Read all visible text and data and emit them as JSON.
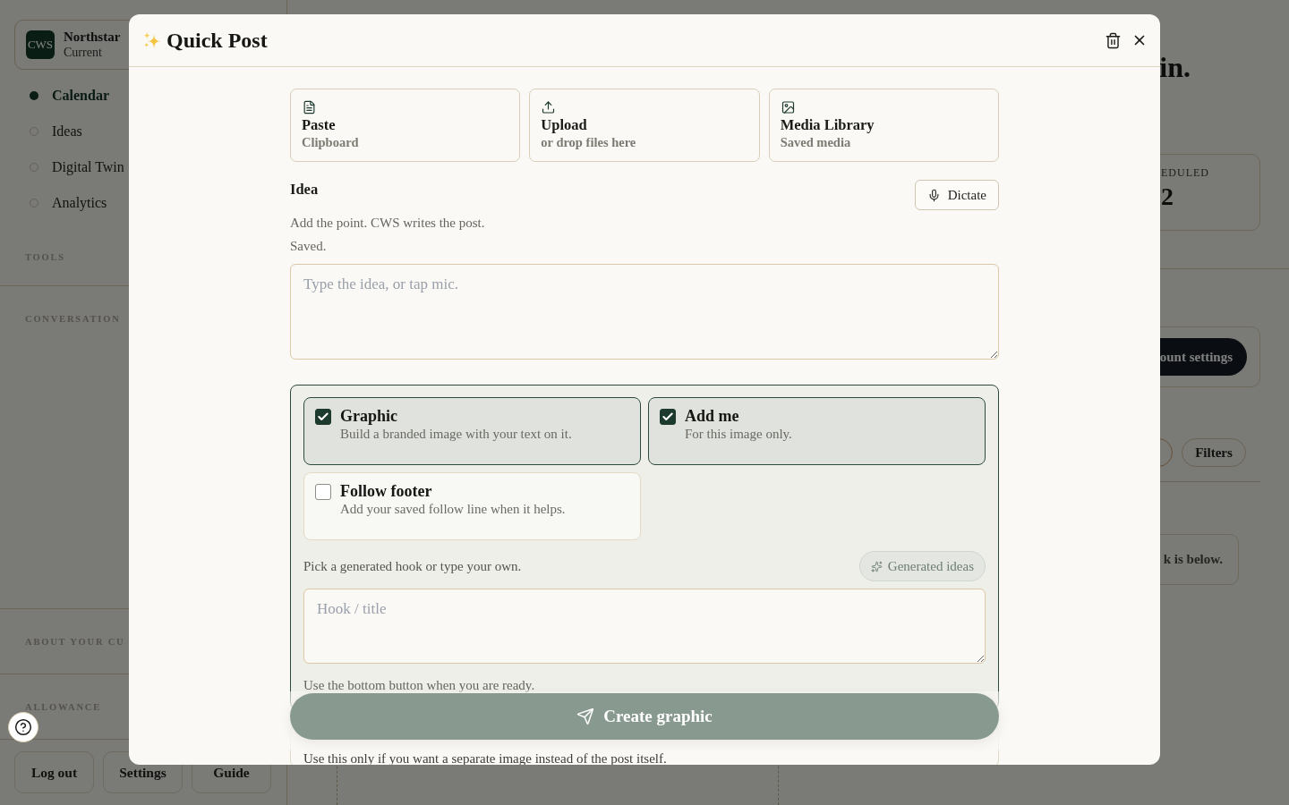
{
  "sidebar": {
    "workspace": {
      "logo": "CWS",
      "name": "Northstar",
      "status": "Current"
    },
    "nav": [
      {
        "label": "Calendar",
        "selected": true
      },
      {
        "label": "Ideas",
        "selected": false
      },
      {
        "label": "Digital Twin",
        "selected": false
      },
      {
        "label": "Analytics",
        "selected": false
      }
    ],
    "top_sections": [
      {
        "title": "TOOLS"
      },
      {
        "title": "CONVERSATION"
      }
    ],
    "bottom_sections": [
      {
        "title": "ABOUT YOUR CU"
      },
      {
        "title": "ALLOWANCE"
      }
    ],
    "buttons": [
      "Log out",
      "Settings",
      "Guide"
    ]
  },
  "main": {
    "heading": "in.",
    "stat": {
      "label": "EDULED",
      "value": "2"
    },
    "settings_button": "ount settings",
    "filters_button": "Filters",
    "notice": "k is below."
  },
  "modal": {
    "title": "Quick Post",
    "sources": [
      {
        "kind": "paste",
        "title": "Paste",
        "subtitle": "Clipboard"
      },
      {
        "kind": "upload",
        "title": "Upload",
        "subtitle": "or drop files here"
      },
      {
        "kind": "media",
        "title": "Media Library",
        "subtitle": "Saved media"
      }
    ],
    "idea": {
      "label": "Idea",
      "dictate_button": "Dictate",
      "hint": "Add the point. CWS writes the post.",
      "status": "Saved.",
      "placeholder": "Type the idea, or tap mic."
    },
    "options": [
      {
        "title": "Graphic",
        "description": "Build a branded image with your text on it.",
        "checked": true
      },
      {
        "title": "Add me",
        "description": "For this image only.",
        "checked": true
      },
      {
        "title": "Follow footer",
        "description": "Add your saved follow line when it helps.",
        "checked": false
      }
    ],
    "hook": {
      "hint": "Pick a generated hook or type your own.",
      "ideas_button": "Generated ideas",
      "placeholder": "Hook / title",
      "note": "Use the bottom button when you are ready."
    },
    "image_style": {
      "description": "Use this only if you want a separate image instead of the post itself."
    },
    "submit_button": "Create graphic"
  }
}
